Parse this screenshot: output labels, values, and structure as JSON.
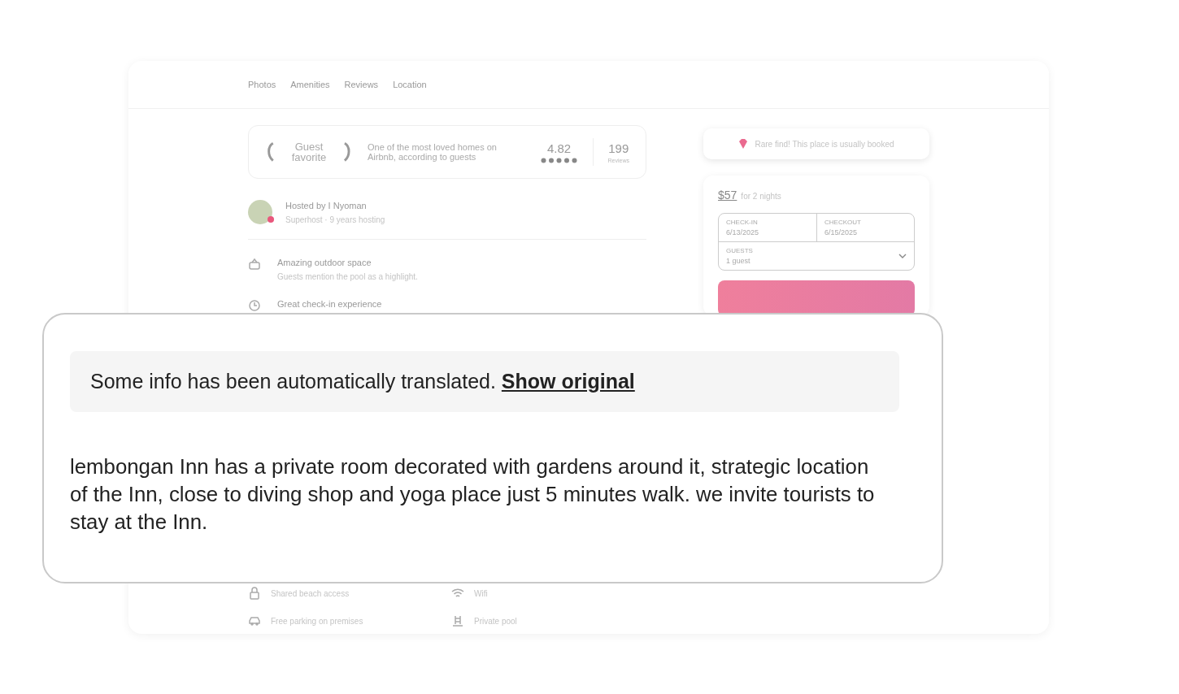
{
  "nav": {
    "tabs": [
      "Photos",
      "Amenities",
      "Reviews",
      "Location"
    ]
  },
  "guest_favorite": {
    "label": "Guest favorite",
    "description": "One of the most loved homes on Airbnb, according to guests",
    "rating": "4.82",
    "stars": 5,
    "reviews_count": "199",
    "reviews_label": "Reviews"
  },
  "host": {
    "title": "Hosted by I Nyoman",
    "subtitle": "Superhost · 9 years hosting"
  },
  "highlights": [
    {
      "title": "Amazing outdoor space",
      "subtitle": "Guests mention the pool as a highlight."
    },
    {
      "title": "Great check-in experience"
    }
  ],
  "amenities": [
    "Shared beach access",
    "Wifi",
    "Free parking on premises",
    "Private pool"
  ],
  "booking": {
    "notice": "Rare find! This place is usually booked",
    "price": "$57",
    "price_note": "for 2 nights",
    "check_in_label": "CHECK-IN",
    "check_in": "6/13/2025",
    "checkout_label": "CHECKOUT",
    "checkout": "6/15/2025",
    "guests_label": "GUESTS",
    "guests": "1 guest"
  },
  "translation_popup": {
    "notice": "Some info has been automatically translated.",
    "link": "Show original",
    "description": "lembongan Inn has a private room decorated with gardens around it, strategic location of the Inn, close to diving shop and yoga place just 5 minutes walk. we invite tourists to stay at the Inn."
  }
}
